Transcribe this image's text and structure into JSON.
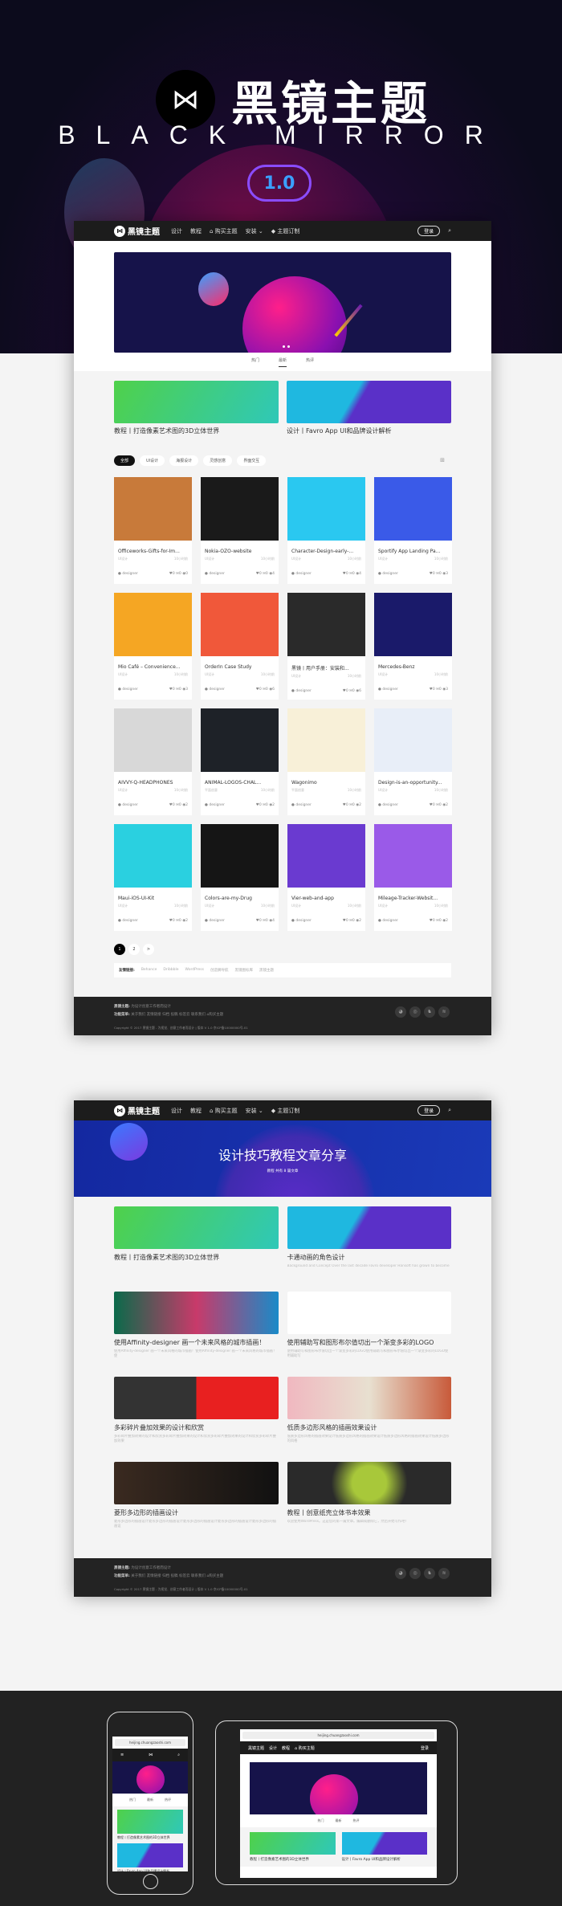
{
  "hero": {
    "logo_glyph": "⋈",
    "title": "黑镜主题",
    "subtitle": "BLACK MIRROR",
    "version": "1.0"
  },
  "nav": {
    "brand": "黑镜主题",
    "items": [
      "设计",
      "教程",
      "⌂ 购买主题",
      "安装 ⌄",
      "◆ 主题订制"
    ],
    "login": "登录",
    "search_icon": "⌕"
  },
  "tabs": [
    "热门",
    "最新",
    "热评"
  ],
  "active_tab": 1,
  "featured": [
    {
      "title": "教程丨打造像素艺术图的3D立体世界",
      "color": "linear-gradient(120deg,#4fd14a,#2fc8b8)"
    },
    {
      "title": "设计丨Favro App UI和品牌设计解析",
      "color": "linear-gradient(120deg,#1fb8e0 40%,#5a30c8 45%)"
    }
  ],
  "filters": [
    "全部",
    "UI设计",
    "海报设计",
    "灵感创意",
    "界面交互"
  ],
  "grid_icon": "⊞",
  "cards": [
    {
      "title": "Officeworks-Gifts-for-Im...",
      "cat": "UI设计",
      "time": "10小时前",
      "author": "designer",
      "likes": 0,
      "comments": 0,
      "views": 0,
      "color": "#c87a3a"
    },
    {
      "title": "Nokia-OZO-website",
      "cat": "UI设计",
      "time": "10小时前",
      "author": "designer",
      "likes": 0,
      "comments": 0,
      "views": 4,
      "color": "#1a1a1a"
    },
    {
      "title": "Character-Design-early-...",
      "cat": "UI设计",
      "time": "10小时前",
      "author": "designer",
      "likes": 0,
      "comments": 0,
      "views": 4,
      "color": "#2ac8f0"
    },
    {
      "title": "Sportify App Landing Pa...",
      "cat": "UI设计",
      "time": "10小时前",
      "author": "designer",
      "likes": 0,
      "comments": 0,
      "views": 3,
      "color": "#3a5ae8"
    },
    {
      "title": "Mio Café – Convenience...",
      "cat": "UI设计",
      "time": "10小时前",
      "author": "designer",
      "likes": 0,
      "comments": 0,
      "views": 3,
      "color": "#f5a623"
    },
    {
      "title": "OrderIn Case Study",
      "cat": "UI设计",
      "time": "10小时前",
      "author": "designer",
      "likes": 0,
      "comments": 0,
      "views": 6,
      "color": "#f0583a"
    },
    {
      "title": "黑镜丨用户手册：安装和...",
      "cat": "UI设计",
      "time": "10小时前",
      "author": "designer",
      "likes": 0,
      "comments": 0,
      "views": 6,
      "color": "#2a2a2a"
    },
    {
      "title": "Mercedes-Benz",
      "cat": "UI设计",
      "time": "10小时前",
      "author": "designer",
      "likes": 0,
      "comments": 0,
      "views": 3,
      "color": "#1a1a6a"
    },
    {
      "title": "AIVVY-Q-HEADPHONES",
      "cat": "UI设计",
      "time": "10小时前",
      "author": "designer",
      "likes": 0,
      "comments": 0,
      "views": 2,
      "color": "#d8d8d8"
    },
    {
      "title": "ANIMAL-LOGOS-CHAL...",
      "cat": "平面创意",
      "time": "10小时前",
      "author": "designer",
      "likes": 0,
      "comments": 0,
      "views": 2,
      "color": "#1e2228"
    },
    {
      "title": "Wagonimo",
      "cat": "平面创意",
      "time": "10小时前",
      "author": "designer",
      "likes": 0,
      "comments": 0,
      "views": 2,
      "color": "#f8f0d8"
    },
    {
      "title": "Design-is-an-opportunity...",
      "cat": "UI设计",
      "time": "10小时前",
      "author": "designer",
      "likes": 0,
      "comments": 0,
      "views": 2,
      "color": "#e8eef8"
    },
    {
      "title": "Maui-iOS-UI-Kit",
      "cat": "UI设计",
      "time": "10小时前",
      "author": "designer",
      "likes": 0,
      "comments": 0,
      "views": 2,
      "color": "#2ad0e0"
    },
    {
      "title": "Colors-are-my-Drug",
      "cat": "UI设计",
      "time": "10小时前",
      "author": "designer",
      "likes": 0,
      "comments": 0,
      "views": 4,
      "color": "#151515"
    },
    {
      "title": "Vier-web-and-app",
      "cat": "UI设计",
      "time": "10小时前",
      "author": "designer",
      "likes": 0,
      "comments": 0,
      "views": 2,
      "color": "#6a3ad0"
    },
    {
      "title": "Mileage-Tracker-Websit...",
      "cat": "UI设计",
      "time": "10小时前",
      "author": "designer",
      "likes": 0,
      "comments": 0,
      "views": 2,
      "color": "#9a5ae8"
    }
  ],
  "pager": [
    "1",
    "2",
    ">"
  ],
  "links": {
    "label": "友情链接:",
    "items": [
      "Behance",
      "Dribbble",
      "WordPress",
      "创造狮导航",
      "黑镜图标库",
      "黑镜主题"
    ]
  },
  "footer": {
    "brand_label": "黑镜主题:",
    "brand_text": "为设计创意工作者而设计",
    "menu_label": "功能菜单:",
    "menu": [
      "关于我们",
      "友情链接",
      "归档",
      "投稿",
      "标签云",
      "联系我们",
      "⌂购买主题"
    ],
    "copyright": "Copyright © 2017 黑镜主题 - 为视觉、创意工作者而设计 | 版本 V 1.0 京ICP备10000000号-01",
    "social": [
      "wechat-icon",
      "weibo-icon",
      "qq-icon",
      "rss-icon"
    ]
  },
  "category": {
    "title": "设计技巧教程文章分享",
    "meta": "教程 共有 8 篇文章"
  },
  "posts": [
    {
      "title": "教程丨打造像素艺术图的3D立体世界",
      "excerpt": "",
      "color": "linear-gradient(120deg,#4fd14a,#2fc8b8)"
    },
    {
      "title": "卡通动画的角色设计",
      "excerpt": "Background and Concept Over the last decade Favro developer Hansoft has grown to become",
      "color": "linear-gradient(120deg,#1fb8e0 40%,#5a30c8 45%)"
    },
    {
      "title": "使用Affinity-designer 画一个未来风格的城市插画！",
      "excerpt": "使用Affinity-designer 画一个未来风格的城市插画！使用Affinity-designer 画一个未来风格的城市插画！使",
      "color": "linear-gradient(90deg,#0a6a4a,#c83a6a,#1a8ac8)"
    },
    {
      "title": "使用辅助写和图形布尔值切出一个渐变多彩的LOGO",
      "excerpt": "使用辅助写和图形布尔值切出一个渐变多彩的LOGO使用辅助写和图形布尔值切出一个渐变多彩的LOGO使用辅助写",
      "color": "#ffffff"
    },
    {
      "title": "多彩碎片叠加效果的设计和欣赏",
      "excerpt": "多彩碎片叠加效果的设计和欣赏多彩碎片叠加效果的设计和欣赏多彩碎片叠加效果的设计和欣赏多彩碎片叠加效果",
      "color": "linear-gradient(90deg,#333 50%,#e82020 50%)"
    },
    {
      "title": "低质多边形风格的插画效果设计",
      "excerpt": "低质多边形风格的插画效果设计低质多边形风格的插画效果设计低质多边形风格的插画效果设计低质多边形的风格",
      "color": "linear-gradient(90deg,#f0b8c0,#e8e0d0,#c85a3a)"
    },
    {
      "title": "菱形多边形的插画设计",
      "excerpt": "菱形多边形的插画设计菱形多边形的插画设计菱形多边形的插画设计菱形多边形的插画设计菱形多边形的插画设",
      "color": "linear-gradient(90deg,#3a2a20,#111)"
    },
    {
      "title": "教程丨创意纸壳立体书本效果",
      "excerpt": "欢迎使用WordPress。这是您的第一篇文章。编辑或删除它，然后开始写作吧！",
      "color": "radial-gradient(circle,#a8c83a 20%,#2a2a2a 45%)"
    }
  ],
  "devices": {
    "url": "heijing.chuangzaoshi.com"
  }
}
